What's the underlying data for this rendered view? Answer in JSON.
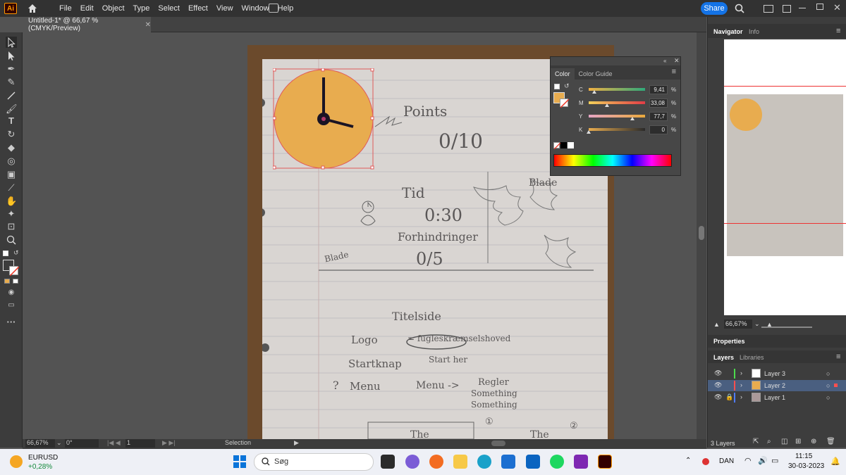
{
  "menubar": {
    "logo": "Ai",
    "items": [
      "File",
      "Edit",
      "Object",
      "Type",
      "Select",
      "Effect",
      "View",
      "Window",
      "Help"
    ],
    "share_label": "Share"
  },
  "document": {
    "tab_title": "Untitled-1* @ 66,67 % (CMYK/Preview)"
  },
  "artwork": {
    "points_label": "Points",
    "points_value": "0/10",
    "tid_label": "Tid",
    "tid_value": "0:30",
    "forhindringer_label": "Forhindringer",
    "blade_label": "Blade",
    "blade_value": "0/5",
    "blade_right": "Blade",
    "titelside": "Titelside",
    "logo": "Logo",
    "logo_desc": "= fugleskræmselshoved",
    "startknap": "Startknap",
    "start_her": "Start her",
    "menu_q": "?",
    "menu_left": "Menu",
    "menu_right": "Menu ->",
    "regler": "Regler",
    "something1": "Something",
    "something2": "Something",
    "num1": "①",
    "num2": "②",
    "the1": "The",
    "the2": "The"
  },
  "clock_color": "#e8ac4f",
  "color_panel": {
    "tabs": [
      "Color",
      "Color Guide"
    ],
    "sliders": [
      {
        "label": "C",
        "value": "9,41",
        "fraction": 0.0941
      },
      {
        "label": "M",
        "value": "33,08",
        "fraction": 0.3308
      },
      {
        "label": "Y",
        "value": "77,7",
        "fraction": 0.777
      },
      {
        "label": "K",
        "value": "0",
        "fraction": 0
      }
    ],
    "unit": "%"
  },
  "status": {
    "zoom": "66,67%",
    "rotation": "0°",
    "artboard": "1",
    "tool": "Selection"
  },
  "navigator": {
    "tabs": [
      "Navigator",
      "Info"
    ],
    "zoom": "66,67%"
  },
  "properties_tab": "Properties",
  "layers": {
    "tabs": [
      "Layers",
      "Libraries"
    ],
    "rows": [
      {
        "name": "Layer 3",
        "color": "#4cdb4c"
      },
      {
        "name": "Layer 2",
        "color": "#ff4f4f"
      },
      {
        "name": "Layer 1",
        "color": "#4f7cff"
      }
    ],
    "count": "3 Layers"
  },
  "taskbar": {
    "ticker": "EURUSD",
    "change": "+0,28%",
    "search_placeholder": "Søg",
    "language": "DAN",
    "time": "11:15",
    "date": "30-03-2023"
  }
}
